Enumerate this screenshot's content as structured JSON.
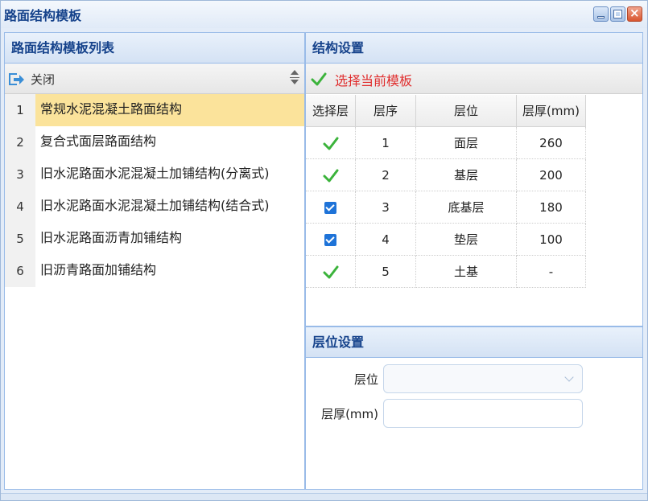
{
  "window": {
    "title": "路面结构模板"
  },
  "template_list": {
    "header": "路面结构模板列表",
    "toolbar_close": "关闭",
    "rows": [
      {
        "num": "1",
        "label": "常规水泥混凝土路面结构",
        "selected": true
      },
      {
        "num": "2",
        "label": "复合式面层路面结构",
        "selected": false
      },
      {
        "num": "3",
        "label": "旧水泥路面水泥混凝土加铺结构(分离式)",
        "selected": false
      },
      {
        "num": "4",
        "label": "旧水泥路面水泥混凝土加铺结构(结合式)",
        "selected": false
      },
      {
        "num": "5",
        "label": "旧水泥路面沥青加铺结构",
        "selected": false
      },
      {
        "num": "6",
        "label": "旧沥青路面加铺结构",
        "selected": false
      }
    ]
  },
  "structure": {
    "header": "结构设置",
    "select_button": "选择当前模板",
    "columns": [
      "选择层",
      "层序",
      "层位",
      "层厚(mm)"
    ],
    "rows": [
      {
        "select": "green-check",
        "order": "1",
        "position": "面层",
        "thickness": "260"
      },
      {
        "select": "green-check",
        "order": "2",
        "position": "基层",
        "thickness": "200"
      },
      {
        "select": "checkbox-checked",
        "order": "3",
        "position": "底基层",
        "thickness": "180"
      },
      {
        "select": "checkbox-checked",
        "order": "4",
        "position": "垫层",
        "thickness": "100"
      },
      {
        "select": "green-check",
        "order": "5",
        "position": "土基",
        "thickness": "-"
      }
    ]
  },
  "layer_settings": {
    "header": "层位设置",
    "position_label": "层位",
    "position_value": "",
    "thickness_label": "层厚(mm)",
    "thickness_value": ""
  },
  "colors": {
    "accent": "#15428b",
    "selected_row": "#fbe39b",
    "select_button_text": "#e02d2d",
    "check_green": "#3bb33b",
    "checkbox_blue": "#1e73d8"
  }
}
